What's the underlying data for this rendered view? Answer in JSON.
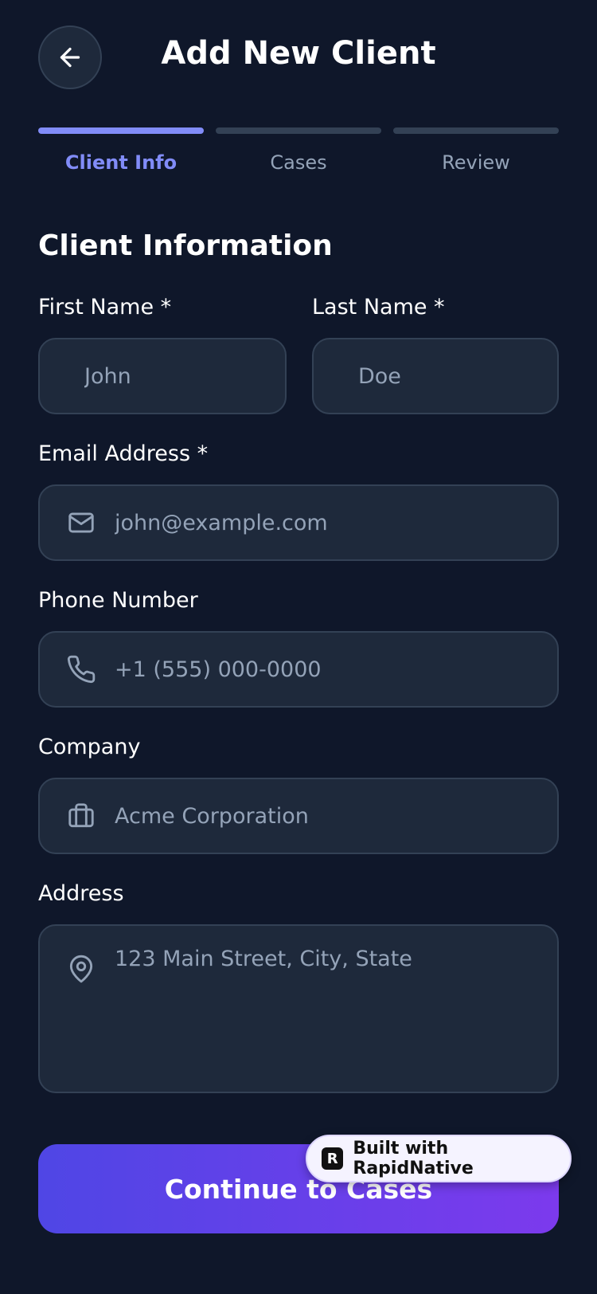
{
  "header": {
    "title": "Add New Client"
  },
  "stepper": {
    "steps": [
      {
        "label": "Client Info",
        "active": true
      },
      {
        "label": "Cases",
        "active": false
      },
      {
        "label": "Review",
        "active": false
      }
    ]
  },
  "form": {
    "section_title": "Client Information",
    "first_name": {
      "label": "First Name *",
      "placeholder": "John",
      "value": ""
    },
    "last_name": {
      "label": "Last Name *",
      "placeholder": "Doe",
      "value": ""
    },
    "email": {
      "label": "Email Address *",
      "placeholder": "john@example.com",
      "icon": "mail-icon"
    },
    "phone": {
      "label": "Phone Number",
      "placeholder": "+1 (555) 000-0000",
      "icon": "phone-icon"
    },
    "company": {
      "label": "Company",
      "placeholder": "Acme Corporation",
      "icon": "briefcase-icon"
    },
    "address": {
      "label": "Address",
      "placeholder": "123 Main Street, City, State",
      "icon": "map-pin-icon"
    }
  },
  "actions": {
    "continue_label": "Continue to Cases"
  },
  "badge": {
    "text": "Built with RapidNative"
  },
  "colors": {
    "background": "#0f172a",
    "field_bg": "#1e293b",
    "accent": "#818cf8",
    "button_gradient_start": "#4f46e5",
    "button_gradient_end": "#7c3aed"
  }
}
